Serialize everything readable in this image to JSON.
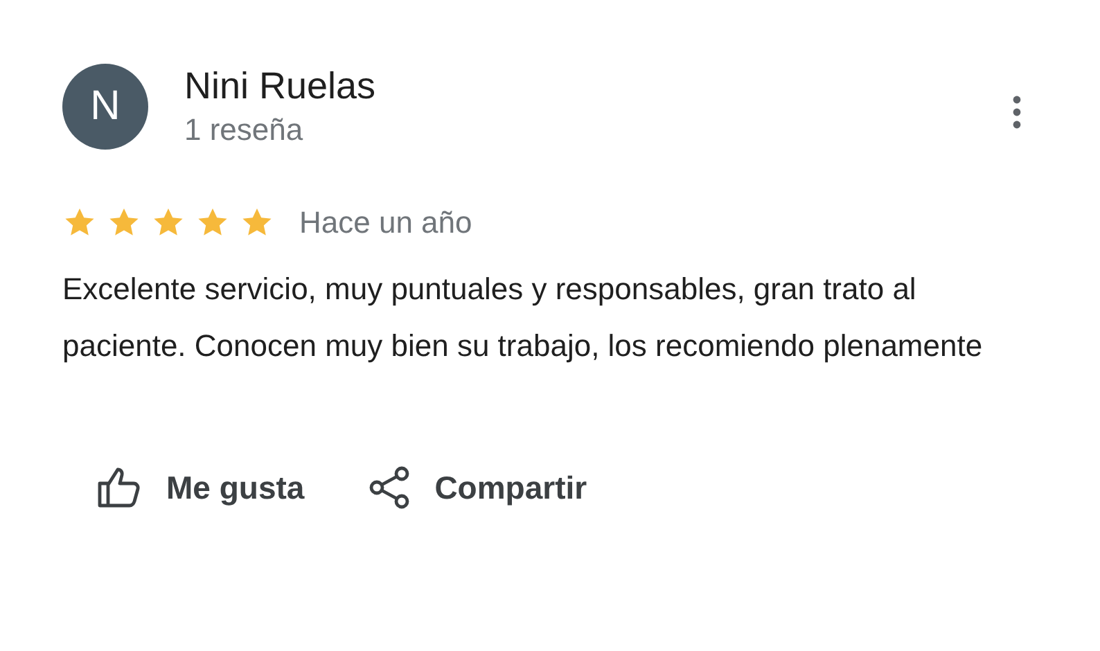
{
  "review": {
    "avatar_letter": "N",
    "author": "Nini Ruelas",
    "author_meta": "1 reseña",
    "stars": 5,
    "time": "Hace un año",
    "text": "Excelente servicio, muy puntuales y responsables, gran trato al paciente. Conocen muy bien su trabajo, los recomiendo plenamente"
  },
  "actions": [
    {
      "kind": "like",
      "label": "Me gusta"
    },
    {
      "kind": "share",
      "label": "Compartir"
    }
  ]
}
